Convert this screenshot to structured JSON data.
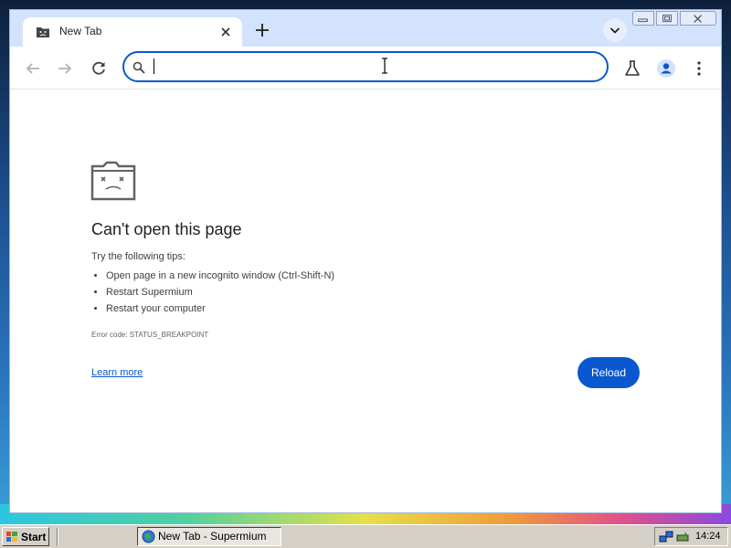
{
  "browser": {
    "tab": {
      "title": "New Tab"
    },
    "omnibox": {
      "value": "",
      "placeholder": ""
    }
  },
  "error_page": {
    "title": "Can't open this page",
    "tips_heading": "Try the following tips:",
    "tips": [
      "Open page in a new incognito window (Ctrl-Shift-N)",
      "Restart Supermium",
      "Restart your computer"
    ],
    "error_code": "Error code: STATUS_BREAKPOINT",
    "learn_more": "Learn more",
    "reload_label": "Reload"
  },
  "taskbar": {
    "start_label": "Start",
    "task_item": "New Tab - Supermium",
    "clock": "14:24"
  },
  "colors": {
    "accent": "#0b57d0",
    "tabstrip": "#d3e3fd",
    "taskbar": "#d4d0c8"
  },
  "icons": [
    "sad-tab-icon",
    "close-icon",
    "plus-icon",
    "chevron-down-icon",
    "back-arrow-icon",
    "forward-arrow-icon",
    "reload-icon",
    "search-icon",
    "labs-flask-icon",
    "profile-icon",
    "kebab-menu-icon",
    "sad-folder-icon",
    "windows-logo-icon",
    "browser-globe-icon",
    "network-icon",
    "safely-remove-icon"
  ]
}
